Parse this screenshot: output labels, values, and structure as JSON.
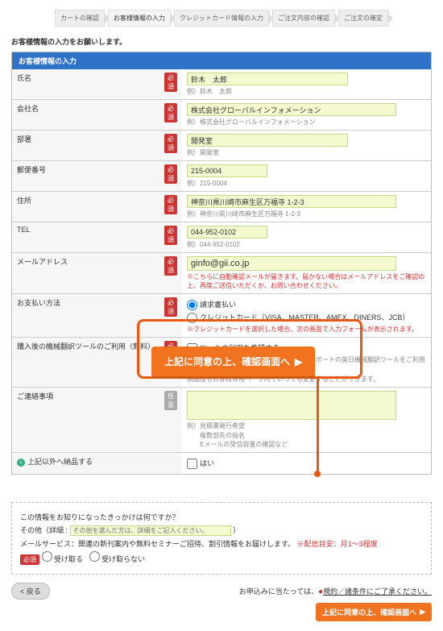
{
  "steps": [
    "カートの確認",
    "お客様情報の入力",
    "クレジットカード情報の入力",
    "ご注文内容の確認",
    "ご注文の確定"
  ],
  "intro": "お客様情報の入力をお願いします。",
  "panel_title": "お客様情報の入力",
  "badge_required": "必須",
  "badge_optional": "任意",
  "rows": {
    "name": {
      "label": "氏名",
      "value": "鈴木　太郎",
      "hint": "例）鈴木　太郎"
    },
    "company": {
      "label": "会社名",
      "value": "株式会社グローバルインフォメーション",
      "hint": "例）株式会社グローバルインフォメーション"
    },
    "dept": {
      "label": "部署",
      "value": "開発室",
      "hint": "例）開発室"
    },
    "zip": {
      "label": "郵便番号",
      "value": "215-0004",
      "hint": "例）215-0004"
    },
    "addr": {
      "label": "住所",
      "value": "神奈川県川崎市麻生区万福寺 1-2-3",
      "hint": "例）神奈川県川崎市麻生区万福寺 1-2-3"
    },
    "tel": {
      "label": "TEL",
      "value": "044-952-0102",
      "hint": "例）044-952-0102"
    },
    "mail": {
      "label": "メールアドレス",
      "value": "ginfo@gii.co.jp",
      "warn": "※こちらに自動確認メールが届きます。届かない場合はメールアドレスをご確認の上、再度ご送信いただくか、お問い合わせください。"
    },
    "pay": {
      "label": "お支払い方法",
      "opt1": "請求書払い",
      "opt2": "クレジットカード（VISA、MASTER、AMEX、DINERS、JCB）",
      "warn": "※クレジットカードを選択した場合、次の画面で入力フォームが表示されます。"
    },
    "mt": {
      "label": "購入後の機械翻訳ツールのご利用（無料）",
      "check": "ツールの利用を希望する",
      "note1": "弊社のレポートをご購入される際は、対象レポートの英日機械翻訳ツールをご利用いただけます。",
      "note2": "納品後もお客様専用ページ内でいつでも変更することができます。"
    },
    "msg": {
      "label": "ご連絡事項",
      "hint": "例）見積書発行希望\n　　複数部先の指名\n　　Eメールの受信容量の確認など"
    },
    "other": {
      "label": "上記以外へ納品する",
      "check": "はい"
    }
  },
  "big_button": "上記に同意の上、確認画面へ",
  "survey": {
    "q": "この情報をお知りになったきっかけは何ですか？",
    "other_label": "その他（詳細 :",
    "other_ph": "その他を選んだ方は、詳細をご記入ください。",
    "close": "）",
    "mail_service": "メールサービス：関連の新刊案内や無料セミナーご招待、割引情報をお届けします。",
    "mail_freq": "※配信目安：月1〜3程度",
    "recv1": "受け取る",
    "recv2": "受け取らない"
  },
  "back": "< 戻る",
  "agree_prefix": "お申込みに当たっては、",
  "agree_link": "規約／諸条件にご了承ください。",
  "confirm_btn": "上記に同意の上、確認画面へ",
  "icon_info": "i"
}
